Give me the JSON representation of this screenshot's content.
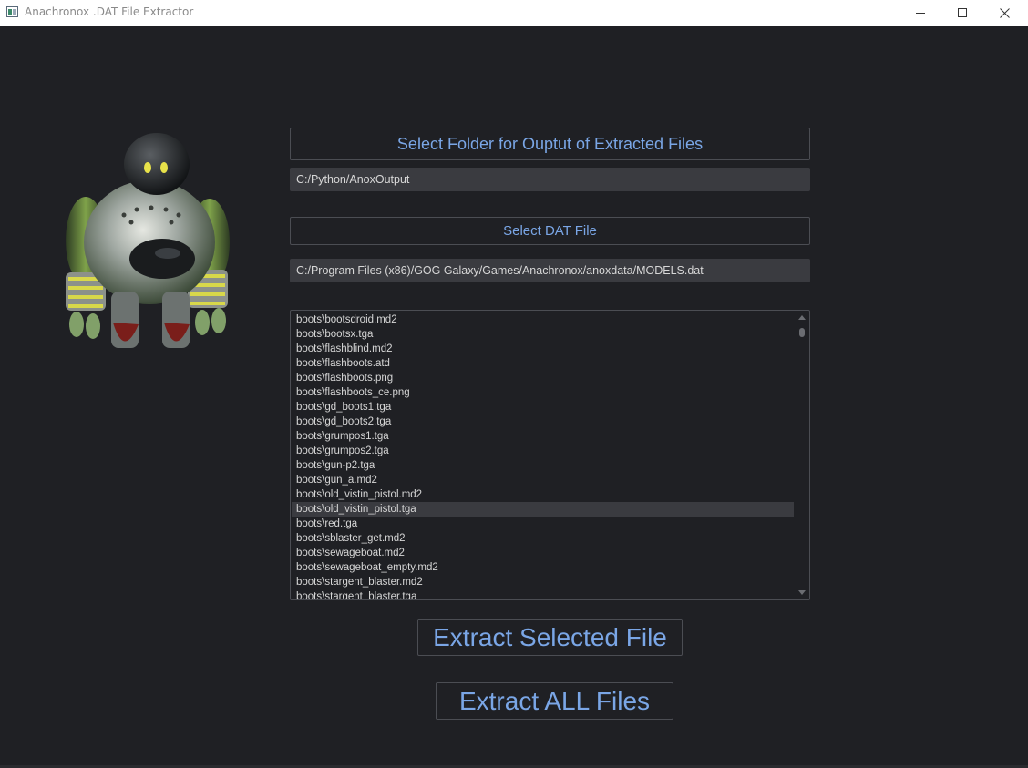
{
  "window": {
    "title": "Anachronox .DAT File Extractor",
    "controls": [
      "minimize-icon",
      "maximize-icon",
      "close-icon"
    ]
  },
  "output_folder": {
    "button_label": "Select Folder for Ouptut of Extracted Files",
    "path": "C:/Python/AnoxOutput"
  },
  "dat_file": {
    "button_label": "Select DAT File",
    "path": "C:/Program Files (x86)/GOG Galaxy/Games/Anachronox/anoxdata/MODELS.dat"
  },
  "file_list": {
    "items": [
      "boots\\bootsdroid.md2",
      "boots\\bootsx.tga",
      "boots\\flashblind.md2",
      "boots\\flashboots.atd",
      "boots\\flashboots.png",
      "boots\\flashboots_ce.png",
      "boots\\gd_boots1.tga",
      "boots\\gd_boots2.tga",
      "boots\\grumpos1.tga",
      "boots\\grumpos2.tga",
      "boots\\gun-p2.tga",
      "boots\\gun_a.md2",
      "boots\\old_vistin_pistol.md2",
      "boots\\old_vistin_pistol.tga",
      "boots\\red.tga",
      "boots\\sblaster_get.md2",
      "boots\\sewageboat.md2",
      "boots\\sewageboat_empty.md2",
      "boots\\stargent_blaster.md2",
      "boots\\stargent_blaster.tga"
    ],
    "selected_index": 13
  },
  "actions": {
    "extract_selected": "Extract Selected File",
    "extract_all": "Extract ALL Files"
  },
  "colors": {
    "background": "#1f2024",
    "accent_text": "#7aa6e6",
    "field_bg": "#3a3b40"
  }
}
